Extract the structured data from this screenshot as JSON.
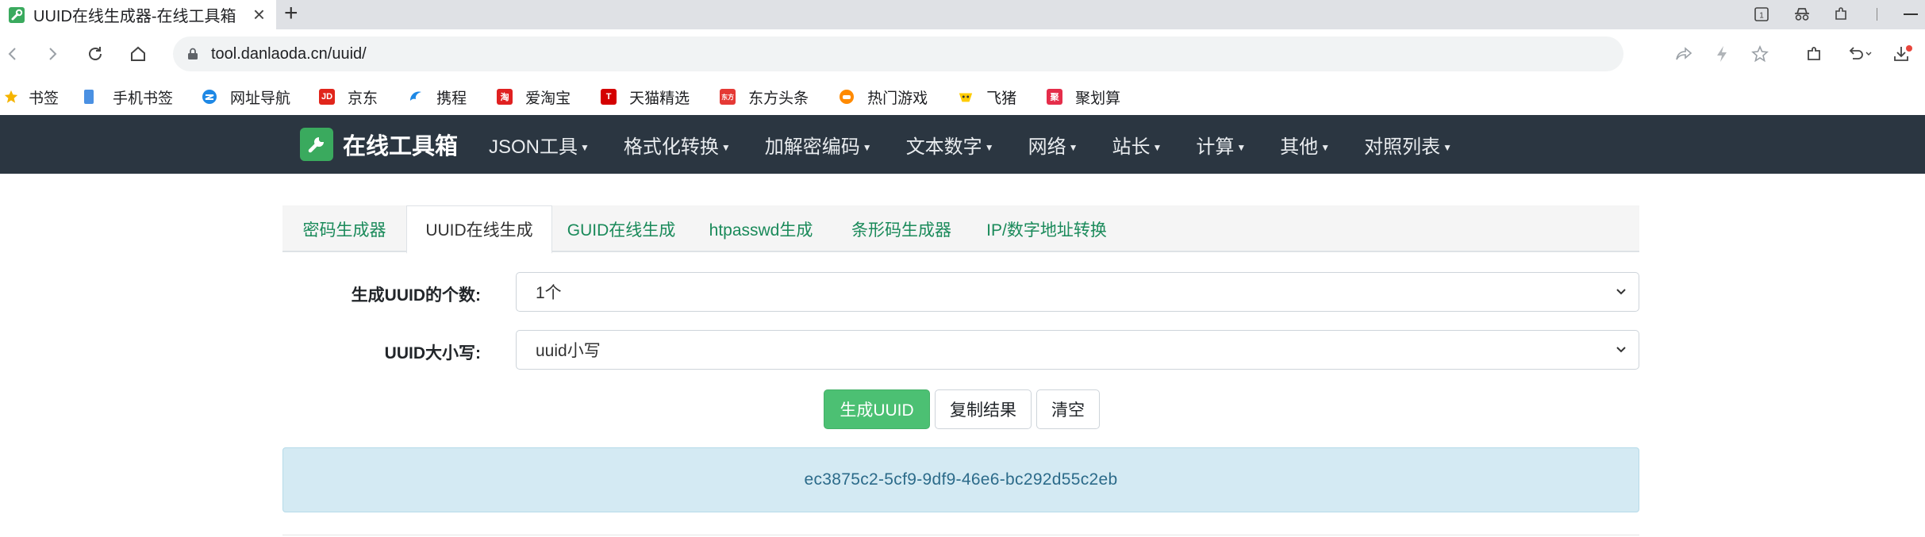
{
  "browser": {
    "tab_title": "UUID在线生成器-在线工具箱",
    "url": "tool.danlaoda.cn/uuid/",
    "tab_count_badge": "1"
  },
  "bookmarks": [
    {
      "label": "书签",
      "icon": "star-icon",
      "color": "#f5b400"
    },
    {
      "label": "手机书签",
      "icon": "phone-icon",
      "color": "#4a90e2"
    },
    {
      "label": "网址导航",
      "icon": "nav-icon",
      "color": "#1e88e5"
    },
    {
      "label": "京东",
      "icon": "jd-icon",
      "color": "#e1251b",
      "badge": "JD"
    },
    {
      "label": "携程",
      "icon": "ctrip-icon",
      "color": "#1e88e5"
    },
    {
      "label": "爱淘宝",
      "icon": "taobao-icon",
      "color": "#e02020",
      "badge": "淘"
    },
    {
      "label": "天猫精选",
      "icon": "tmall-icon",
      "color": "#d40000",
      "badge": "T"
    },
    {
      "label": "东方头条",
      "icon": "dftt-icon",
      "color": "#e53935",
      "badge": "东方"
    },
    {
      "label": "热门游戏",
      "icon": "game-icon",
      "color": "#ff8a00"
    },
    {
      "label": "飞猪",
      "icon": "fliggy-icon",
      "color": "#ffcc00"
    },
    {
      "label": "聚划算",
      "icon": "juhuasuan-icon",
      "color": "#e52d4a",
      "badge": "聚"
    }
  ],
  "navbar": {
    "brand": "在线工具箱",
    "menu": [
      "JSON工具",
      "格式化转换",
      "加解密编码",
      "文本数字",
      "网络",
      "站长",
      "计算",
      "其他",
      "对照列表"
    ]
  },
  "tabs": [
    "密码生成器",
    "UUID在线生成",
    "GUID在线生成",
    "htpasswd生成",
    "条形码生成器",
    "IP/数字地址转换"
  ],
  "active_tab": "UUID在线生成",
  "form": {
    "count_label": "生成UUID的个数:",
    "count_value": "1个",
    "case_label": "UUID大小写:",
    "case_value": "uuid小写"
  },
  "buttons": {
    "generate": "生成UUID",
    "copy": "复制结果",
    "clear": "清空"
  },
  "result": "ec3875c2-5cf9-9df9-46e6-bc292d55c2eb",
  "colors": {
    "navbar_bg": "#2b3641",
    "brand_green": "#3aaa5e",
    "primary_button": "#4cc073",
    "result_bg": "#d4eaf3",
    "tab_link": "#1a8a5a"
  }
}
